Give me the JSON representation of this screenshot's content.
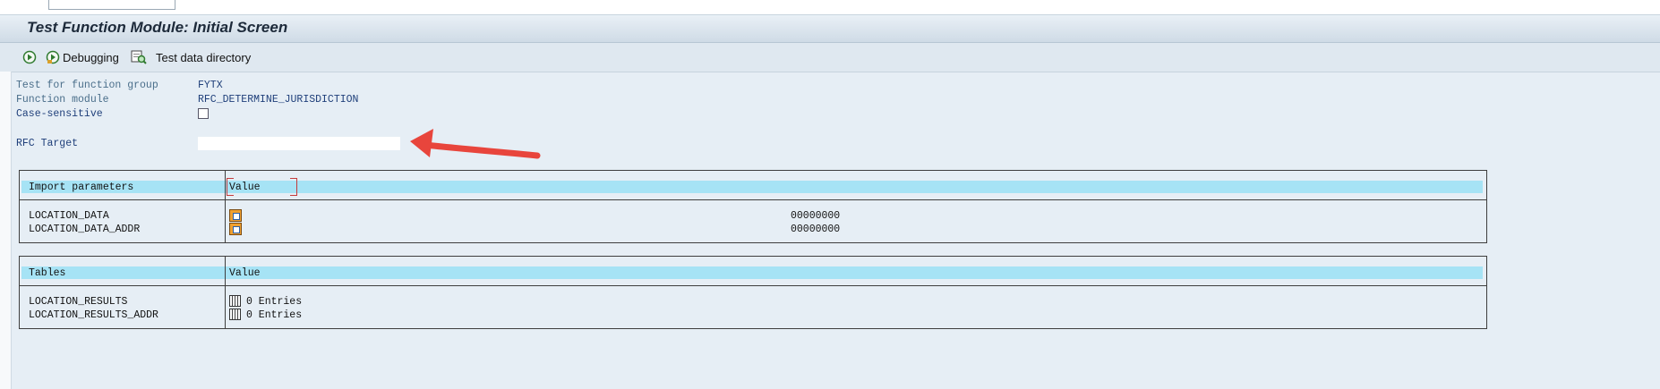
{
  "window": {
    "title": "Test Function Module: Initial Screen"
  },
  "toolbar": {
    "debugging_label": "Debugging",
    "test_data_dir_label": "Test data directory"
  },
  "form": {
    "fg_label": "Test for function group",
    "fg_value": "FYTX",
    "fm_label": "Function module",
    "fm_value": "RFC_DETERMINE_JURISDICTION",
    "case_label": "Case-sensitive",
    "rfc_label": "RFC Target",
    "rfc_value": ""
  },
  "import_params": {
    "col1": "Import parameters",
    "col2": "Value",
    "rows": [
      {
        "name": "LOCATION_DATA",
        "value": "00000000"
      },
      {
        "name": "LOCATION_DATA_ADDR",
        "value": "00000000"
      }
    ]
  },
  "tables": {
    "col1": "Tables",
    "col2": "Value",
    "rows": [
      {
        "name": "LOCATION_RESULTS",
        "value": "0 Entries"
      },
      {
        "name": "LOCATION_RESULTS_ADDR",
        "value": "0 Entries"
      }
    ]
  },
  "colors": {
    "header_fill": "#a6e3f5",
    "arrow": "#e8453c",
    "label": "#4a6e8a",
    "value": "#1f3f7a"
  },
  "icons": [
    "execute-icon",
    "debug-execute-icon",
    "test-data-directory-icon",
    "structure-icon",
    "table-icon"
  ]
}
